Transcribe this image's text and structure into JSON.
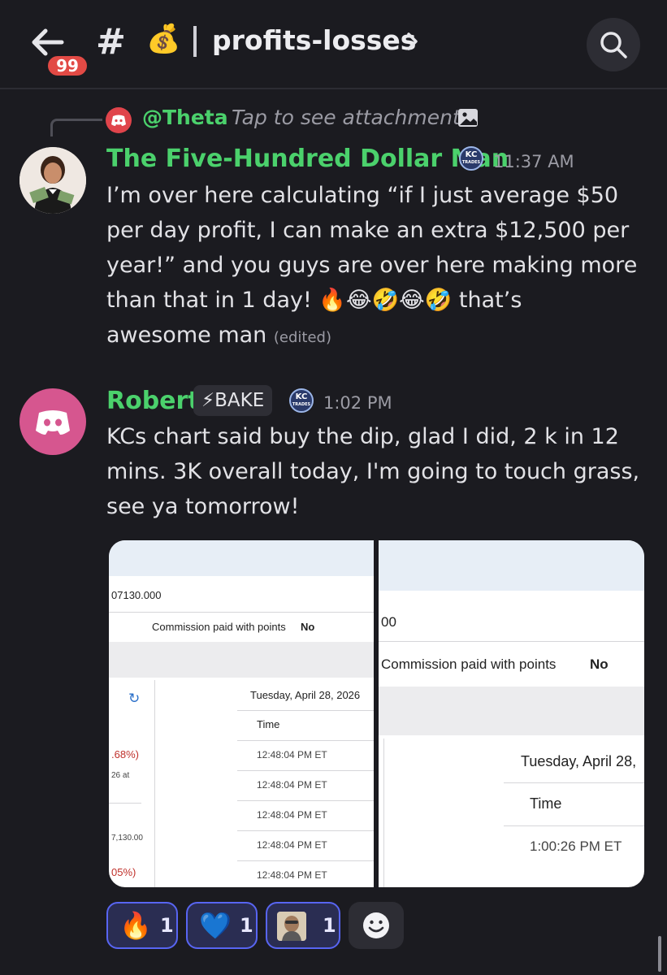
{
  "header": {
    "unread_badge": "99",
    "hash": "#",
    "channel_emoji": "💰",
    "channel_name": "profits-losses",
    "back_icon": "arrow-left-icon",
    "search_icon": "search-icon"
  },
  "reply": {
    "mention": "@Theta",
    "hint": "Tap to see attachment"
  },
  "messages": [
    {
      "author": "The Five-Hundred Dollar Man",
      "time": "11:37 AM",
      "lines": [
        "I’m over here calculating “if I just average $50",
        "per day profit, I can make an extra $12,500 per",
        "year!” and you guys are over here making more",
        "than that in 1 day! 🔥😂🤣😂🤣 that’s",
        "awesome man"
      ],
      "edited": "(edited)"
    },
    {
      "author": "Robert",
      "role": "⚡BAKE",
      "time": "1:02 PM",
      "lines": [
        "KCs chart said buy the dip, glad I did, 2 k in 12",
        "mins.  3K overall today, I'm going to touch grass,",
        "see ya tomorrow!"
      ]
    }
  ],
  "badge_text": "KC\nTRADES",
  "attachment1": {
    "amount": "07130.000",
    "commission_label": "Commission paid with points",
    "commission_value": "No",
    "date": "Tuesday, April 28, 2026",
    "time_header": "Time",
    "pct1": ".68%)",
    "small1": "26 at",
    "small2": "7,130.00",
    "pct2": "05%)",
    "times": [
      "12:48:04 PM ET",
      "12:48:04 PM ET",
      "12:48:04 PM ET",
      "12:48:04 PM ET",
      "12:48:04 PM ET"
    ]
  },
  "attachment2": {
    "amount": "00",
    "commission_label": "Commission paid with points",
    "commission_value": "No",
    "date": "Tuesday, April 28,",
    "time_header": "Time",
    "time": "1:00:26 PM ET"
  },
  "reactions": [
    {
      "emoji": "🔥",
      "count": "1"
    },
    {
      "emoji": "💙",
      "count": "1"
    },
    {
      "emoji": "avatar-image",
      "count": "1"
    }
  ]
}
